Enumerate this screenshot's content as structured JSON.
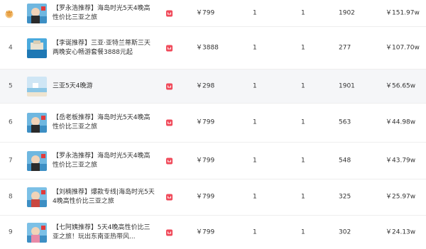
{
  "rows": [
    {
      "rank": "",
      "title": "【罗永浩推荐】海岛时光5天4晚高性价比三亚之旅",
      "price": "￥799",
      "col1": "1",
      "col2": "1",
      "sales": "1902",
      "gmv": "￥151.97w",
      "thumb": "person"
    },
    {
      "rank": "4",
      "title": "【李诞推荐】三亚·亚特兰蒂斯三天两晚安心畅游套餐3888元起",
      "price": "￥3888",
      "col1": "1",
      "col2": "1",
      "sales": "277",
      "gmv": "￥107.70w",
      "thumb": "resort"
    },
    {
      "rank": "5",
      "title": "三亚5天4晚游",
      "price": "￥298",
      "col1": "1",
      "col2": "1",
      "sales": "1901",
      "gmv": "￥56.65w",
      "thumb": "beach"
    },
    {
      "rank": "6",
      "title": "【岳老板推荐】海岛时光5天4晚高性价比三亚之旅",
      "price": "￥799",
      "col1": "1",
      "col2": "1",
      "sales": "563",
      "gmv": "￥44.98w",
      "thumb": "person"
    },
    {
      "rank": "7",
      "title": "【罗永浩推荐】海岛时光5天4晚高性价比三亚之旅",
      "price": "￥799",
      "col1": "1",
      "col2": "1",
      "sales": "548",
      "gmv": "￥43.79w",
      "thumb": "person"
    },
    {
      "rank": "8",
      "title": "【刘楠推荐】爆款专线|海岛时光5天4晚高性价比三亚之旅",
      "price": "￥799",
      "col1": "1",
      "col2": "1",
      "sales": "325",
      "gmv": "￥25.97w",
      "thumb": "person"
    },
    {
      "rank": "9",
      "title": "【七阿姨推荐】5天4晚高性价比三亚之旅！玩出东南亚热带风...",
      "price": "￥799",
      "col1": "1",
      "col2": "1",
      "sales": "302",
      "gmv": "￥24.13w",
      "thumb": "person"
    }
  ],
  "colors": {
    "accent": "#f04a5a",
    "alt_row": "#f5f6f8",
    "crown": "#e8a34a"
  },
  "icons": {
    "rank_badge": "crown-icon",
    "shop": "shop-icon"
  }
}
